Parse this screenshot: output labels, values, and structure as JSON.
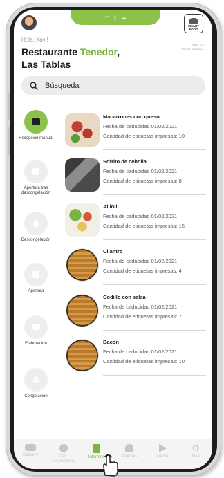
{
  "status_bar": {
    "icons": [
      "wifi-icon",
      "bluetooth-icon",
      "cloud-icon"
    ]
  },
  "header": {
    "greeting": "Hola, Xavi!",
    "restaurant_prefix": "Restaurante ",
    "restaurant_accent": "Tenedor",
    "restaurant_suffix": ",",
    "location": "Las Tablas",
    "logo_line1": "SMART",
    "logo_line2": "FOOD",
    "version": "REV. 1.0",
    "date": "Fecha: 21/09/21"
  },
  "search": {
    "placeholder": "Búsqueda"
  },
  "rail": [
    {
      "label": "Recepción manual",
      "active": true,
      "icon": "box-icon"
    },
    {
      "label": "Apertura tras descongelación",
      "active": false,
      "icon": "snow-box-icon"
    },
    {
      "label": "Descongelación",
      "active": false,
      "icon": "drop-icon"
    },
    {
      "label": "Apertura",
      "active": false,
      "icon": "open-box-icon"
    },
    {
      "label": "Elaboración",
      "active": false,
      "icon": "pot-icon"
    },
    {
      "label": "Congelación",
      "active": false,
      "icon": "snowflake-icon"
    }
  ],
  "items": [
    {
      "name": "Macarrones con queso",
      "expiry": "Fecha de caducidad 01/02/2021",
      "labels": "Cantidad de etiquetas impresas: 10"
    },
    {
      "name": "Sofrito de cebolla",
      "expiry": "Fecha de caducidad 01/02/2021",
      "labels": "Cantidad de etiquetas impresas: 8"
    },
    {
      "name": "Allioli",
      "expiry": "Fecha de caducidad 01/02/2021",
      "labels": "Cantidad de etiquetas impresas: 15"
    },
    {
      "name": "Cilantro",
      "expiry": "Fecha de caducidad 01/02/2021",
      "labels": "Cantidad de etiquetas impresas: 4"
    },
    {
      "name": "Codillo con salsa",
      "expiry": "Fecha de caducidad 01/02/2021",
      "labels": "Cantidad de etiquetas impresas: 7"
    },
    {
      "name": "Bacon",
      "expiry": "Fecha de caducidad 01/02/2021",
      "labels": "Cantidad de etiquetas impresas: 10"
    }
  ],
  "bottom_nav": [
    {
      "label": "Delivery",
      "icon": "truck-icon",
      "active": false
    },
    {
      "label": "Cad. secundarias",
      "icon": "clock-icon",
      "active": false
    },
    {
      "label": "Informes",
      "icon": "document-icon",
      "active": true
    },
    {
      "label": "Alarmas",
      "icon": "bell-icon",
      "active": false
    },
    {
      "label": "Media",
      "icon": "play-icon",
      "active": false
    },
    {
      "label": "Más",
      "icon": "gear-icon",
      "active": false
    }
  ],
  "colors": {
    "accent": "#8bc34a",
    "accent_text": "#7cb342"
  }
}
